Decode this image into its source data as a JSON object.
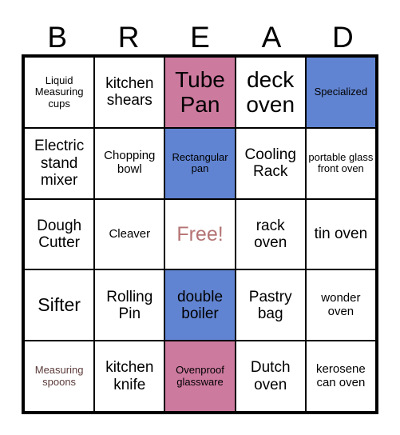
{
  "card": {
    "title_letters": [
      "B",
      "R",
      "E",
      "A",
      "D"
    ],
    "columns": 5,
    "rows": 5,
    "colors": {
      "pink": "#cd7a9f",
      "blue": "#6184d2",
      "free_text": "#b57373",
      "maroon_text": "#5c3a3a",
      "border": "#000000",
      "background": "#ffffff"
    },
    "cells": [
      {
        "label": "Liquid Measuring cups",
        "fill": "none",
        "size": "xs",
        "text_color": "black"
      },
      {
        "label": "kitchen shears",
        "fill": "none",
        "size": "md",
        "text_color": "black"
      },
      {
        "label": "Tube Pan",
        "fill": "pink",
        "size": "xl",
        "text_color": "black"
      },
      {
        "label": "deck oven",
        "fill": "none",
        "size": "xl",
        "text_color": "black"
      },
      {
        "label": "Specialized",
        "fill": "blue",
        "size": "xs",
        "text_color": "black"
      },
      {
        "label": "Electric stand mixer",
        "fill": "none",
        "size": "md",
        "text_color": "black"
      },
      {
        "label": "Chopping bowl",
        "fill": "none",
        "size": "sm",
        "text_color": "black"
      },
      {
        "label": "Rectangular pan",
        "fill": "blue",
        "size": "xs",
        "text_color": "black"
      },
      {
        "label": "Cooling Rack",
        "fill": "none",
        "size": "md",
        "text_color": "black"
      },
      {
        "label": "portable glass front oven",
        "fill": "none",
        "size": "xs",
        "text_color": "black"
      },
      {
        "label": "Dough Cutter",
        "fill": "none",
        "size": "md",
        "text_color": "black"
      },
      {
        "label": "Cleaver",
        "fill": "none",
        "size": "sm",
        "text_color": "black"
      },
      {
        "label": "Free!",
        "fill": "none",
        "size": "lg",
        "text_color": "rose"
      },
      {
        "label": "rack oven",
        "fill": "none",
        "size": "md",
        "text_color": "black"
      },
      {
        "label": "tin oven",
        "fill": "none",
        "size": "md",
        "text_color": "black"
      },
      {
        "label": "Sifter",
        "fill": "none",
        "size": "lg",
        "text_color": "black"
      },
      {
        "label": "Rolling Pin",
        "fill": "none",
        "size": "md",
        "text_color": "black"
      },
      {
        "label": "double boiler",
        "fill": "blue",
        "size": "md",
        "text_color": "black"
      },
      {
        "label": "Pastry bag",
        "fill": "none",
        "size": "md",
        "text_color": "black"
      },
      {
        "label": "wonder oven",
        "fill": "none",
        "size": "sm",
        "text_color": "black"
      },
      {
        "label": "Measuring spoons",
        "fill": "none",
        "size": "xs",
        "text_color": "maroon"
      },
      {
        "label": "kitchen knife",
        "fill": "none",
        "size": "md",
        "text_color": "black"
      },
      {
        "label": "Ovenproof glassware",
        "fill": "pink",
        "size": "xs",
        "text_color": "black"
      },
      {
        "label": "Dutch oven",
        "fill": "none",
        "size": "md",
        "text_color": "black"
      },
      {
        "label": "kerosene can oven",
        "fill": "none",
        "size": "sm",
        "text_color": "black"
      }
    ]
  }
}
